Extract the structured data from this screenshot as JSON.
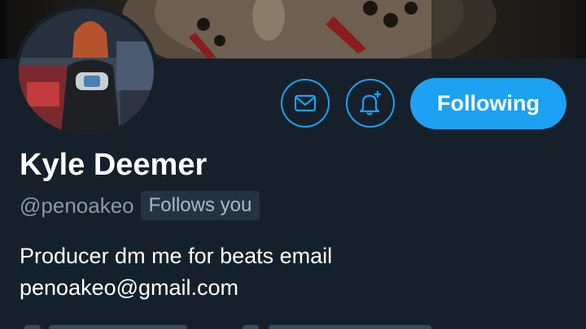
{
  "profile": {
    "name": "Kyle Deemer",
    "handle": "@penoakeo",
    "follows_you_badge": "Follows you",
    "bio_line1": "Producer dm me for beats email",
    "bio_line2": "penoakeo@gmail.com"
  },
  "actions": {
    "message_icon": "mail-icon",
    "notify_icon": "bell-plus-icon",
    "follow_label": "Following"
  },
  "colors": {
    "background": "#15202b",
    "accent": "#1da1f2",
    "secondary_text": "#8899a6",
    "badge_bg": "#253341"
  }
}
